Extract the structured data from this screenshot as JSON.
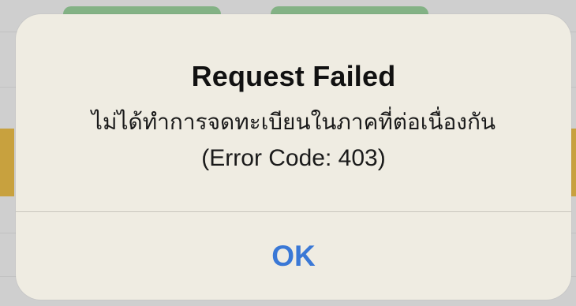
{
  "alert": {
    "title": "Request Failed",
    "message_thai": "ไม่ได้ทำการจดทะเบียนในภาคที่ต่อเนื่องกัน",
    "error_code_text": "(Error Code: 403)",
    "ok_button_label": "OK"
  },
  "colors": {
    "dialog_background": "#efece2",
    "ok_button_text": "#3a78d6",
    "title_text": "#111111",
    "separator": "#c9c6bd"
  }
}
